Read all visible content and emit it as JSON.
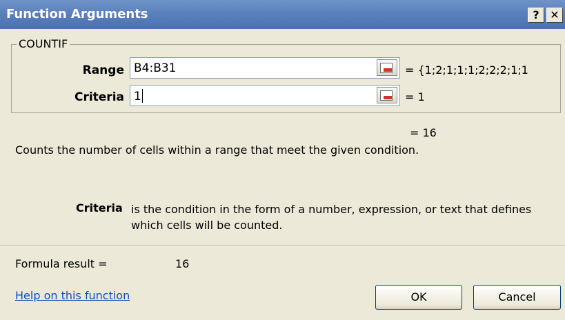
{
  "window": {
    "title": "Function Arguments",
    "help_button": "?",
    "close_button": "✕"
  },
  "function": {
    "name": "COUNTIF",
    "args": [
      {
        "label": "Range",
        "value": "B4:B31",
        "result": "= {1;2;1;1;1;2;2;2;1;1"
      },
      {
        "label": "Criteria",
        "value": "1",
        "result": "= 1"
      }
    ],
    "total_result": "= 16",
    "description": "Counts the number of cells within a range that meet the given condition."
  },
  "help": {
    "arg_name": "Criteria",
    "text": "is the condition in the form of a number, expression, or text that defines which cells will be counted."
  },
  "footer": {
    "formula_result_label": "Formula result =",
    "formula_result_value": "16",
    "help_link": "Help on this function",
    "ok_label": "OK",
    "cancel_label": "Cancel"
  }
}
